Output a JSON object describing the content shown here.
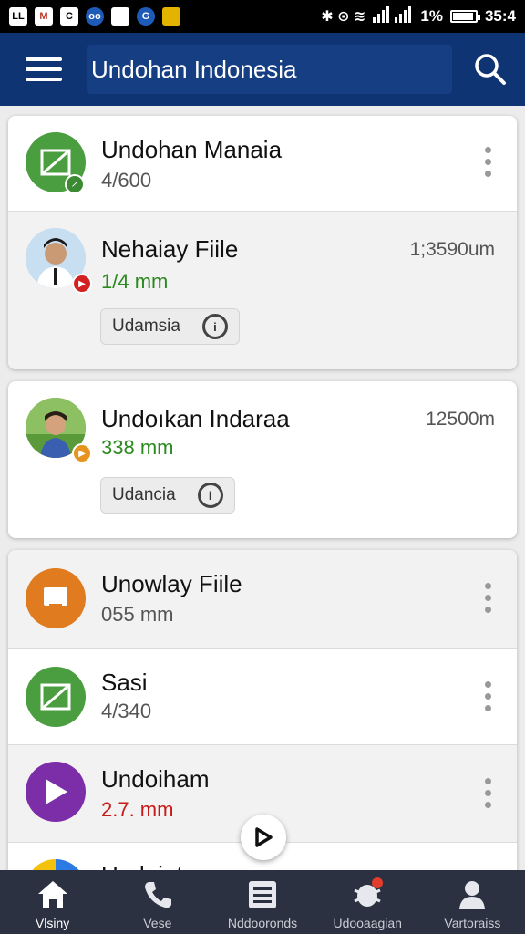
{
  "status_bar": {
    "left_icons": [
      "LL",
      "M",
      "C",
      "oo",
      "",
      "G",
      ""
    ],
    "signal_symbols": "✱ ⊙ ≋",
    "battery_percent": "1%",
    "battery_level": 0.85,
    "time": "35:4"
  },
  "app_bar": {
    "title": "Undohan Indonesia",
    "menu_icon": "hamburger-icon",
    "search_icon": "search-icon"
  },
  "cards": [
    {
      "rows": [
        {
          "title": "Undohan Manaia",
          "subtitle": "4/600",
          "meta": "",
          "icon": "green-video-icon",
          "badge": "green",
          "chip": ""
        },
        {
          "title": "Nehaiay Fiile",
          "subtitle": "1/4 mm",
          "meta": "1;3590um",
          "icon": "person-avatar-icon",
          "badge": "red",
          "chip": "Udamsia"
        }
      ]
    },
    {
      "rows": [
        {
          "title": "Undoıkan Indaraa",
          "subtitle": "338 mm",
          "meta": "12500m",
          "icon": "person-avatar-icon",
          "badge": "orange",
          "chip": "Udancia"
        }
      ]
    },
    {
      "rows": [
        {
          "title": "Unowlay Fiile",
          "subtitle": "055 mm",
          "meta": "",
          "icon": "orange-file-icon"
        },
        {
          "title": "Sasi",
          "subtitle": "4/340",
          "meta": "",
          "icon": "green-video-icon"
        },
        {
          "title": "Undoiham",
          "subtitle": "2.7. mm",
          "meta": "",
          "icon": "purple-play-icon"
        },
        {
          "title": "Undoiat",
          "subtitle": "",
          "meta": "",
          "icon": "multicolor-icon"
        }
      ]
    }
  ],
  "bottom_nav": [
    {
      "label": "Vlsiny",
      "icon": "home-icon",
      "active": true
    },
    {
      "label": "Vese",
      "icon": "phone-icon",
      "active": false
    },
    {
      "label": "Nddooronds",
      "icon": "list-icon",
      "active": false
    },
    {
      "label": "Udooaagian",
      "icon": "bug-icon",
      "active": false,
      "badge": true
    },
    {
      "label": "Vartoraiss",
      "icon": "person-icon",
      "active": false
    }
  ],
  "colors": {
    "app_bar": "#0f3474",
    "green": "#4a9e3f",
    "orange": "#e07b1f",
    "purple": "#7b2ea8",
    "nav": "#2b3140"
  }
}
